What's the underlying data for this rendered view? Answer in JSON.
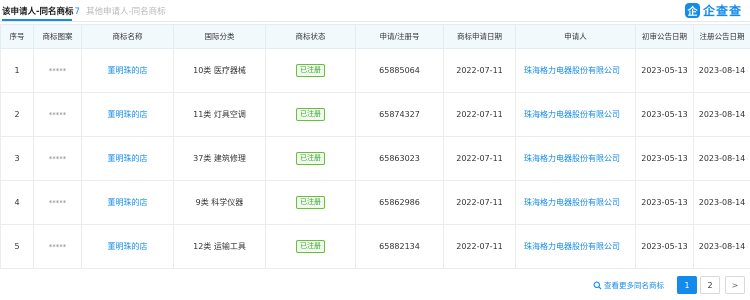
{
  "tabs": {
    "active_label": "该申请人-同名商标",
    "active_count": "7",
    "inactive_label": "其他申请人-同名商标"
  },
  "brand": {
    "badge": "企",
    "name": "企查查"
  },
  "table": {
    "headers": [
      "序号",
      "商标图案",
      "商标名称",
      "国际分类",
      "商标状态",
      "申请/注册号",
      "商标申请日期",
      "申请人",
      "初审公告日期",
      "注册公告日期"
    ],
    "rows": [
      {
        "index": "1",
        "logo": "*****",
        "name": "董明珠的店",
        "category": "10类 医疗器械",
        "status": "已注册",
        "reg_no": "65885064",
        "apply_date": "2022-07-11",
        "applicant": "珠海格力电器股份有限公司",
        "prelim_date": "2023-05-13",
        "reg_date": "2023-08-14"
      },
      {
        "index": "2",
        "logo": "*****",
        "name": "董明珠的店",
        "category": "11类 灯具空调",
        "status": "已注册",
        "reg_no": "65874327",
        "apply_date": "2022-07-11",
        "applicant": "珠海格力电器股份有限公司",
        "prelim_date": "2023-05-13",
        "reg_date": "2023-08-14"
      },
      {
        "index": "3",
        "logo": "*****",
        "name": "董明珠的店",
        "category": "37类 建筑修理",
        "status": "已注册",
        "reg_no": "65863023",
        "apply_date": "2022-07-11",
        "applicant": "珠海格力电器股份有限公司",
        "prelim_date": "2023-05-13",
        "reg_date": "2023-08-14"
      },
      {
        "index": "4",
        "logo": "*****",
        "name": "董明珠的店",
        "category": "9类 科学仪器",
        "status": "已注册",
        "reg_no": "65862986",
        "apply_date": "2022-07-11",
        "applicant": "珠海格力电器股份有限公司",
        "prelim_date": "2023-05-13",
        "reg_date": "2023-08-14"
      },
      {
        "index": "5",
        "logo": "*****",
        "name": "董明珠的店",
        "category": "12类 运输工具",
        "status": "已注册",
        "reg_no": "65882134",
        "apply_date": "2022-07-11",
        "applicant": "珠海格力电器股份有限公司",
        "prelim_date": "2023-05-13",
        "reg_date": "2023-08-14"
      }
    ]
  },
  "footer": {
    "more_label": "查看更多同名商标",
    "pages": [
      "1",
      "2"
    ],
    "current_page": "1",
    "next_symbol": ">"
  },
  "colors": {
    "accent": "#128bed",
    "status_green": "#3aa53a",
    "header_bg": "#f2f9fd"
  }
}
